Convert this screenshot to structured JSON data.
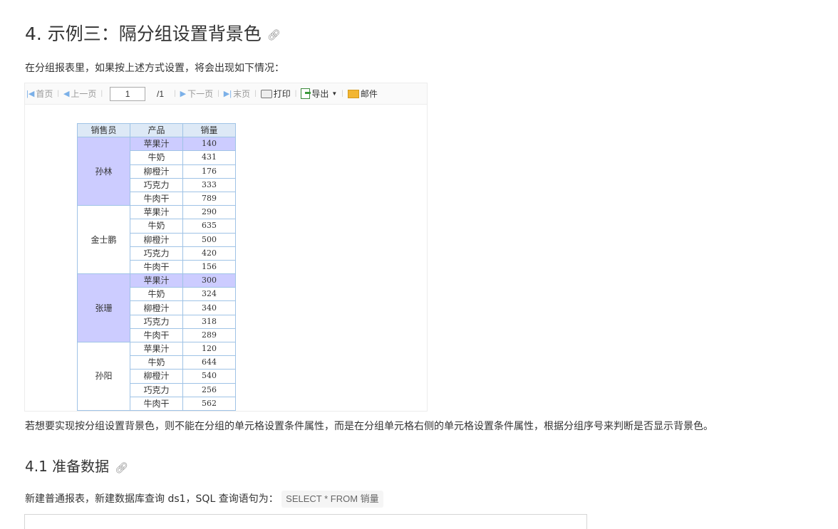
{
  "heading": {
    "title": "4. 示例三：隔分组设置背景色",
    "anchor_icon": "link-icon"
  },
  "intro": "在分组报表里，如果按上述方式设置，将会出现如下情况：",
  "toolbar": {
    "first": "首页",
    "prev": "上一页",
    "page_value": "1",
    "page_total": "/1",
    "next": "下一页",
    "last": "末页",
    "print": "打印",
    "export": "导出",
    "mail": "邮件"
  },
  "report": {
    "headers": [
      "销售员",
      "产品",
      "销量"
    ],
    "highlight_color": "#ccccff",
    "groups": [
      {
        "seller": "孙林",
        "highlight": true,
        "rows": [
          [
            "苹果汁",
            "140"
          ],
          [
            "牛奶",
            "431"
          ],
          [
            "柳橙汁",
            "176"
          ],
          [
            "巧克力",
            "333"
          ],
          [
            "牛肉干",
            "789"
          ]
        ]
      },
      {
        "seller": "金士鹏",
        "highlight": false,
        "rows": [
          [
            "苹果汁",
            "290"
          ],
          [
            "牛奶",
            "635"
          ],
          [
            "柳橙汁",
            "500"
          ],
          [
            "巧克力",
            "420"
          ],
          [
            "牛肉干",
            "156"
          ]
        ]
      },
      {
        "seller": "张珊",
        "highlight": true,
        "rows": [
          [
            "苹果汁",
            "300"
          ],
          [
            "牛奶",
            "324"
          ],
          [
            "柳橙汁",
            "340"
          ],
          [
            "巧克力",
            "318"
          ],
          [
            "牛肉干",
            "289"
          ]
        ]
      },
      {
        "seller": "孙阳",
        "highlight": false,
        "rows": [
          [
            "苹果汁",
            "120"
          ],
          [
            "牛奶",
            "644"
          ],
          [
            "柳橙汁",
            "540"
          ],
          [
            "巧克力",
            "256"
          ],
          [
            "牛肉干",
            "562"
          ]
        ]
      }
    ]
  },
  "explain": "若想要实现按分组设置背景色，则不能在分组的单元格设置条件属性，而是在分组单元格右侧的单元格设置条件属性，根据分组序号来判断是否显示背景色。",
  "subheading": {
    "title": "4.1 准备数据"
  },
  "prepare": {
    "text": "新建普通报表，新建数据库查询 ds1，SQL 查询语句为：",
    "code": "SELECT * FROM 销量"
  }
}
